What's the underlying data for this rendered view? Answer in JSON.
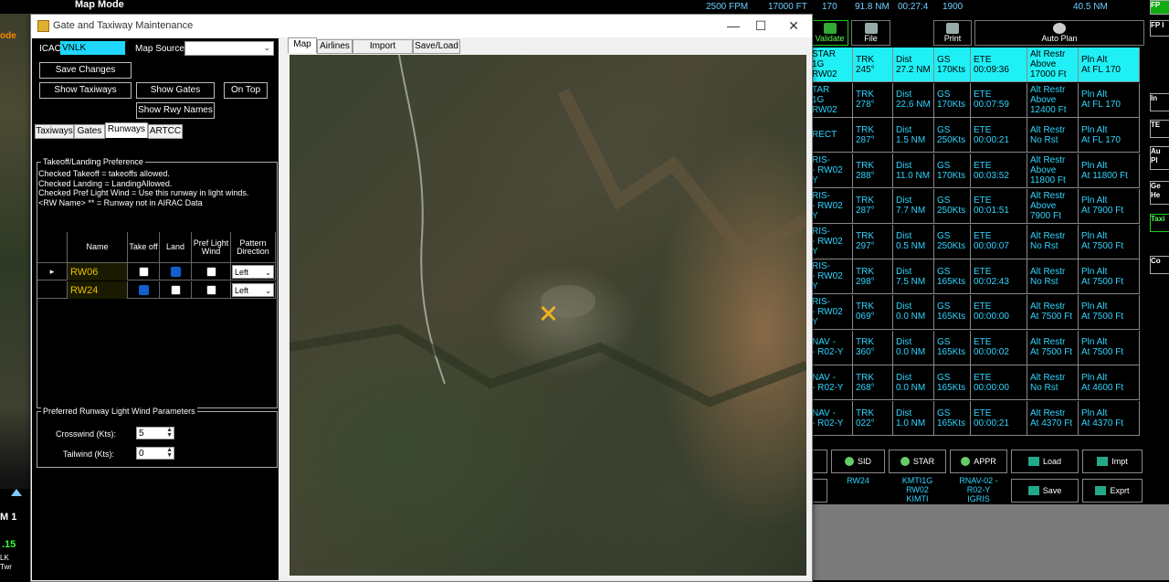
{
  "background": {
    "map_mode_label": "Map Mode",
    "left_mode_fragment": "ode",
    "left_bottom_fragments": [
      "M 1",
      ".15",
      "LK",
      "Twr"
    ]
  },
  "fms": {
    "status": [
      "2500 FPM",
      "17000 FT",
      "170",
      "91.8 NM",
      "00:27:4",
      "1900",
      "40.5 NM"
    ],
    "toolbar": {
      "validate": "Validate",
      "file": "File",
      "print": "Print",
      "auto_plan": "Auto Plan"
    },
    "rows": [
      {
        "proc": [
          "STAR",
          "1G RW02"
        ],
        "trk": [
          "TRK",
          "245°"
        ],
        "dist": [
          "Dist",
          "27.2 NM"
        ],
        "gs": [
          "GS",
          "170Kts"
        ],
        "ete": [
          "ETE",
          "00:09:36"
        ],
        "alt": [
          "Alt Restr",
          "Above",
          "17000 Ft"
        ],
        "pln": [
          "Pln Alt",
          "At FL 170"
        ],
        "selected": true
      },
      {
        "proc": [
          "TAR",
          "1G RW02"
        ],
        "trk": [
          "TRK",
          "278°"
        ],
        "dist": [
          "Dist",
          "22.6 NM"
        ],
        "gs": [
          "GS",
          "170Kts"
        ],
        "ete": [
          "ETE",
          "00:07:59"
        ],
        "alt": [
          "Alt Restr",
          "Above",
          "12400 Ft"
        ],
        "pln": [
          "Pln Alt",
          "At FL 170"
        ]
      },
      {
        "proc": [
          "RECT",
          ""
        ],
        "trk": [
          "TRK",
          "287°"
        ],
        "dist": [
          "Dist",
          "1.5 NM"
        ],
        "gs": [
          "GS",
          "250Kts"
        ],
        "ete": [
          "ETE",
          "00:00:21"
        ],
        "alt": [
          "Alt Restr",
          "No Rst"
        ],
        "pln": [
          "Pln Alt",
          "At FL 170"
        ]
      },
      {
        "proc": [
          "RIS-",
          "- RW02",
          "Y"
        ],
        "trk": [
          "TRK",
          "288°"
        ],
        "dist": [
          "Dist",
          "11.0 NM"
        ],
        "gs": [
          "GS",
          "170Kts"
        ],
        "ete": [
          "ETE",
          "00:03:52"
        ],
        "alt": [
          "Alt Restr",
          "Above",
          "11800 Ft"
        ],
        "pln": [
          "Pln Alt",
          "At 11800 Ft"
        ]
      },
      {
        "proc": [
          "RIS-",
          "- RW02",
          "Y"
        ],
        "trk": [
          "TRK",
          "287°"
        ],
        "dist": [
          "Dist",
          "7.7 NM"
        ],
        "gs": [
          "GS",
          "250Kts"
        ],
        "ete": [
          "ETE",
          "00:01:51"
        ],
        "alt": [
          "Alt Restr",
          "Above",
          "7900 Ft"
        ],
        "pln": [
          "Pln Alt",
          "At 7900 Ft"
        ]
      },
      {
        "proc": [
          "RIS-",
          "- RW02",
          "Y"
        ],
        "trk": [
          "TRK",
          "297°"
        ],
        "dist": [
          "Dist",
          "0.5 NM"
        ],
        "gs": [
          "GS",
          "250Kts"
        ],
        "ete": [
          "ETE",
          "00:00:07"
        ],
        "alt": [
          "Alt Restr",
          "No Rst"
        ],
        "pln": [
          "Pln Alt",
          "At 7500 Ft"
        ]
      },
      {
        "proc": [
          "RIS-",
          "- RW02",
          "Y"
        ],
        "trk": [
          "TRK",
          "298°"
        ],
        "dist": [
          "Dist",
          "7.5 NM"
        ],
        "gs": [
          "GS",
          "165Kts"
        ],
        "ete": [
          "ETE",
          "00:02:43"
        ],
        "alt": [
          "Alt Restr",
          "No Rst"
        ],
        "pln": [
          "Pln Alt",
          "At 7500 Ft"
        ]
      },
      {
        "proc": [
          "RIS-",
          "- RW02",
          "Y"
        ],
        "trk": [
          "TRK",
          "069°"
        ],
        "dist": [
          "Dist",
          "0.0 NM"
        ],
        "gs": [
          "GS",
          "165Kts"
        ],
        "ete": [
          "ETE",
          "00:00:00"
        ],
        "alt": [
          "Alt Restr",
          "At 7500 Ft"
        ],
        "pln": [
          "Pln Alt",
          "At 7500 Ft"
        ]
      },
      {
        "proc": [
          "NAV -",
          "- R02-Y"
        ],
        "trk": [
          "TRK",
          "360°"
        ],
        "dist": [
          "Dist",
          "0.0 NM"
        ],
        "gs": [
          "GS",
          "165Kts"
        ],
        "ete": [
          "ETE",
          "00:00:02"
        ],
        "alt": [
          "Alt Restr",
          "At 7500 Ft"
        ],
        "pln": [
          "Pln Alt",
          "At 7500 Ft"
        ]
      },
      {
        "proc": [
          "NAV -",
          "- R02-Y"
        ],
        "trk": [
          "TRK",
          "268°"
        ],
        "dist": [
          "Dist",
          "0.0 NM"
        ],
        "gs": [
          "GS",
          "165Kts"
        ],
        "ete": [
          "ETE",
          "00:00:00"
        ],
        "alt": [
          "Alt Restr",
          "No Rst"
        ],
        "pln": [
          "Pln Alt",
          "At 4600 Ft"
        ]
      },
      {
        "proc": [
          "NAV -",
          "- R02-Y"
        ],
        "trk": [
          "TRK",
          "022°"
        ],
        "dist": [
          "Dist",
          "1.0 NM"
        ],
        "gs": [
          "GS",
          "165Kts"
        ],
        "ete": [
          "ETE",
          "00:00:21"
        ],
        "alt": [
          "Alt Restr",
          "At 4370 Ft"
        ],
        "pln": [
          "Pln Alt",
          "At 4370 Ft"
        ]
      }
    ],
    "footer": {
      "sid": "SID",
      "star": "STAR",
      "appr": "APPR",
      "load": "Load",
      "impt": "Impt",
      "save": "Save",
      "exprt": "Exprt",
      "sid_value": "RW24",
      "star_value": [
        "KMTI1G",
        "RW02",
        "KIMTI"
      ],
      "appr_value": [
        "RNAV-02 -",
        "R02-Y",
        "IGRIS"
      ]
    },
    "strip": [
      "FP",
      "FP I",
      "In",
      "TE",
      "Au",
      "Pl",
      "Ge",
      "He",
      "Taxi",
      "Co"
    ]
  },
  "window": {
    "title": "Gate and Taxiway Maintenance",
    "icao_label": "ICAO",
    "icao_value": "VNLK",
    "map_source_label": "Map Source:",
    "buttons": {
      "save_changes": "Save Changes",
      "show_taxiways": "Show Taxiways",
      "show_gates": "Show Gates",
      "on_top": "On Top",
      "show_rwy_names": "Show Rwy Names"
    },
    "left_tabs": [
      "Taxiways",
      "Gates",
      "Runways",
      "ARTCC"
    ],
    "active_left_tab": "Runways",
    "right_tabs": [
      "Map",
      "Airlines",
      "Import Scenery",
      "Save/Load"
    ],
    "active_right_tab": "Map",
    "takeoff_group": "Takeoff/Landing Preference",
    "help_lines": [
      "Checked Takeoff = takeoffs allowed.",
      "Checked Landing = LandingAllowed.",
      "Checked Pref Light Wind = Use this runway in light winds.",
      "<RW Name> ** = Runway not in AIRAC Data"
    ],
    "grid_headers": [
      "Name",
      "Take off",
      "Land",
      "Pref Light Wind",
      "Pattern Direction"
    ],
    "runways": [
      {
        "name": "RW06",
        "takeoff": false,
        "land": true,
        "pref": false,
        "pattern": "Left"
      },
      {
        "name": "RW24",
        "takeoff": true,
        "land": false,
        "pref": false,
        "pattern": "Left"
      }
    ],
    "pref_group": "Preferred Runway Light Wind Parameters",
    "crosswind_label": "Crosswind (Kts):",
    "crosswind_value": "5",
    "tailwind_label": "Tailwind (Kts):",
    "tailwind_value": "0"
  },
  "colors": {
    "fms_text": "#2fd6ff",
    "selected_row": "#1ff0f5",
    "runway_name": "#e8c000",
    "validate_green": "#5cff5c"
  }
}
